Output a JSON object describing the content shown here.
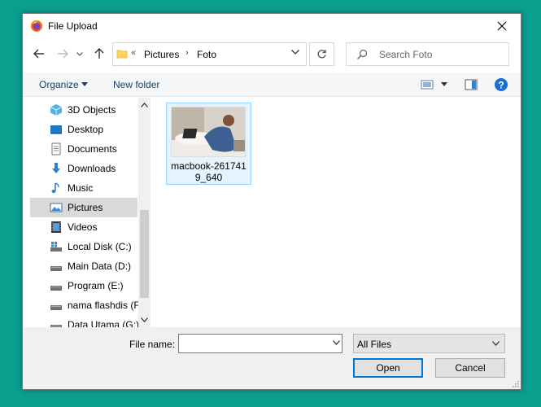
{
  "window": {
    "title": "File Upload"
  },
  "address": {
    "overflow": "«",
    "crumbs": [
      "Pictures",
      "Foto"
    ]
  },
  "search": {
    "placeholder": "Search Foto"
  },
  "toolbar": {
    "organize_label": "Organize",
    "new_folder_label": "New folder"
  },
  "nav": {
    "items": [
      {
        "label": "3D Objects",
        "icon": "3d-objects-icon"
      },
      {
        "label": "Desktop",
        "icon": "desktop-icon"
      },
      {
        "label": "Documents",
        "icon": "documents-icon"
      },
      {
        "label": "Downloads",
        "icon": "downloads-icon"
      },
      {
        "label": "Music",
        "icon": "music-icon"
      },
      {
        "label": "Pictures",
        "icon": "pictures-icon",
        "selected": true
      },
      {
        "label": "Videos",
        "icon": "videos-icon"
      },
      {
        "label": "Local Disk (C:)",
        "icon": "windows-drive-icon"
      },
      {
        "label": "Main Data (D:)",
        "icon": "drive-icon"
      },
      {
        "label": "Program (E:)",
        "icon": "drive-icon"
      },
      {
        "label": "nama flashdis (F",
        "icon": "drive-icon"
      },
      {
        "label": "Data Utama (G:)",
        "icon": "drive-icon"
      }
    ]
  },
  "files": [
    {
      "name_line1": "macbook-261741",
      "name_line2": "9_640"
    }
  ],
  "bottom": {
    "file_name_label": "File name:",
    "file_name_value": "",
    "file_type_value": "All Files",
    "open_label": "Open",
    "cancel_label": "Cancel"
  },
  "colors": {
    "accent": "#0078d7",
    "background": "#0a9e8e",
    "selection": "#d9d9d9"
  }
}
